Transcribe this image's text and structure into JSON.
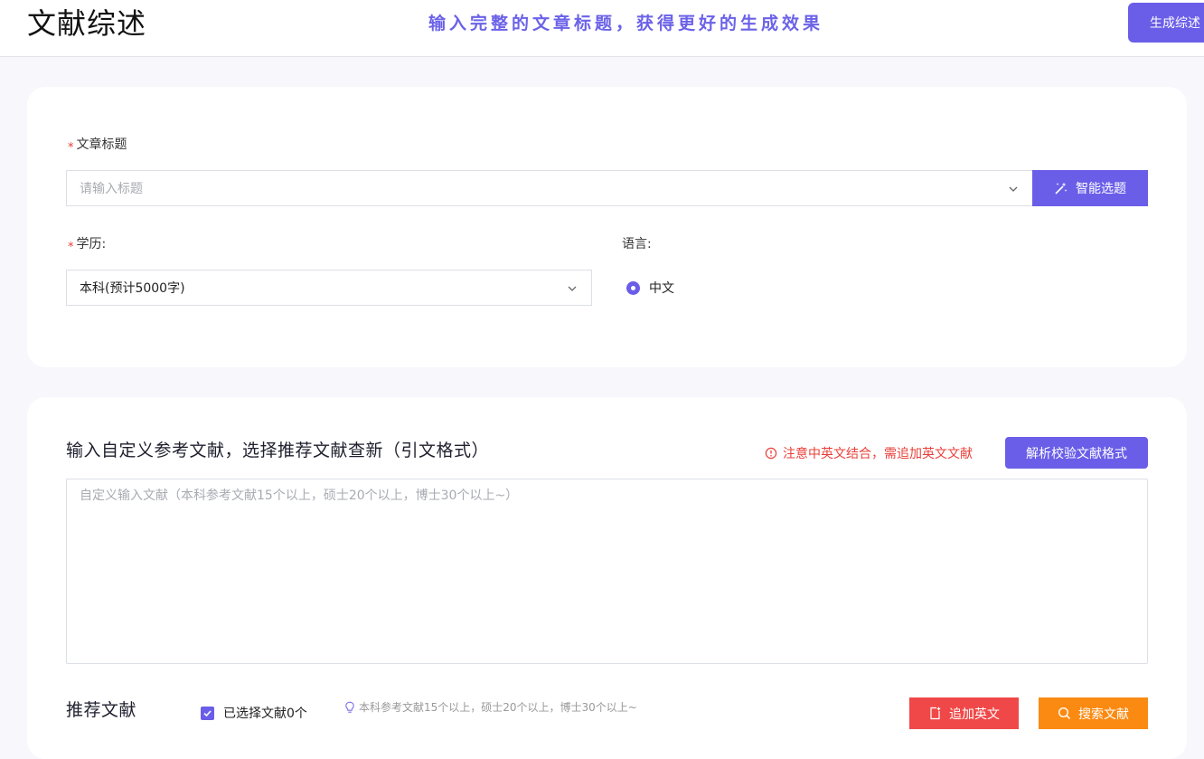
{
  "header": {
    "title": "文献综述",
    "hint": "输入完整的文章标题，获得更好的生成效果",
    "generate_button": "生成综述"
  },
  "form": {
    "title_field": {
      "required_mark": "*",
      "label": "文章标题",
      "placeholder": "请输入标题",
      "smart_button": "智能选题"
    },
    "education_field": {
      "required_mark": "*",
      "label": "学历:",
      "value": "本科(预计5000字)"
    },
    "language_field": {
      "label": "语言:",
      "option": "中文",
      "selected": true
    }
  },
  "references": {
    "title": "输入自定义参考文献，选择推荐文献查新（引文格式）",
    "warning": "注意中英文结合，需追加英文文献",
    "parse_button": "解析校验文献格式",
    "textarea_placeholder": "自定义输入文献（本科参考文献15个以上，硕士20个以上，博士30个以上~）",
    "textarea_value": ""
  },
  "recommended": {
    "title": "推荐文献",
    "selected_label": "已选择文献0个",
    "selected_checked": true,
    "hint": "本科参考文献15个以上，硕士20个以上，博士30个以上~",
    "add_english_button": "追加英文",
    "search_button": "搜索文献"
  },
  "colors": {
    "accent": "#6a5ee8",
    "danger": "#f04848",
    "warning_orange": "#fb8a12",
    "warning_text": "#e8403a"
  }
}
